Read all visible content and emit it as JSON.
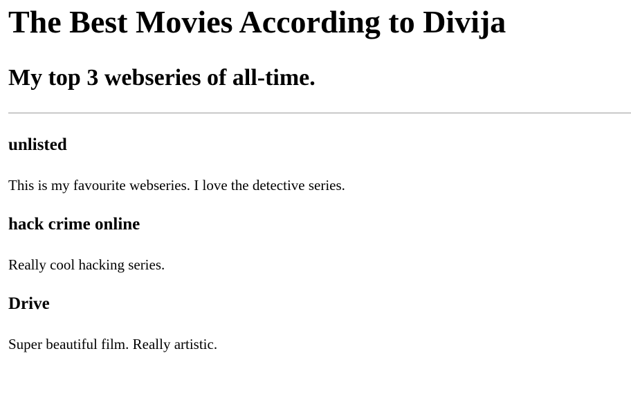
{
  "page": {
    "title": "The Best Movies According to Divija",
    "subtitle": "My top 3 webseries of all-time."
  },
  "entries": [
    {
      "title": "unlisted",
      "description": "This is my favourite webseries. I love the detective series."
    },
    {
      "title": "hack crime online",
      "description": "Really cool hacking series."
    },
    {
      "title": "Drive",
      "description": "Super beautiful film. Really artistic."
    }
  ]
}
